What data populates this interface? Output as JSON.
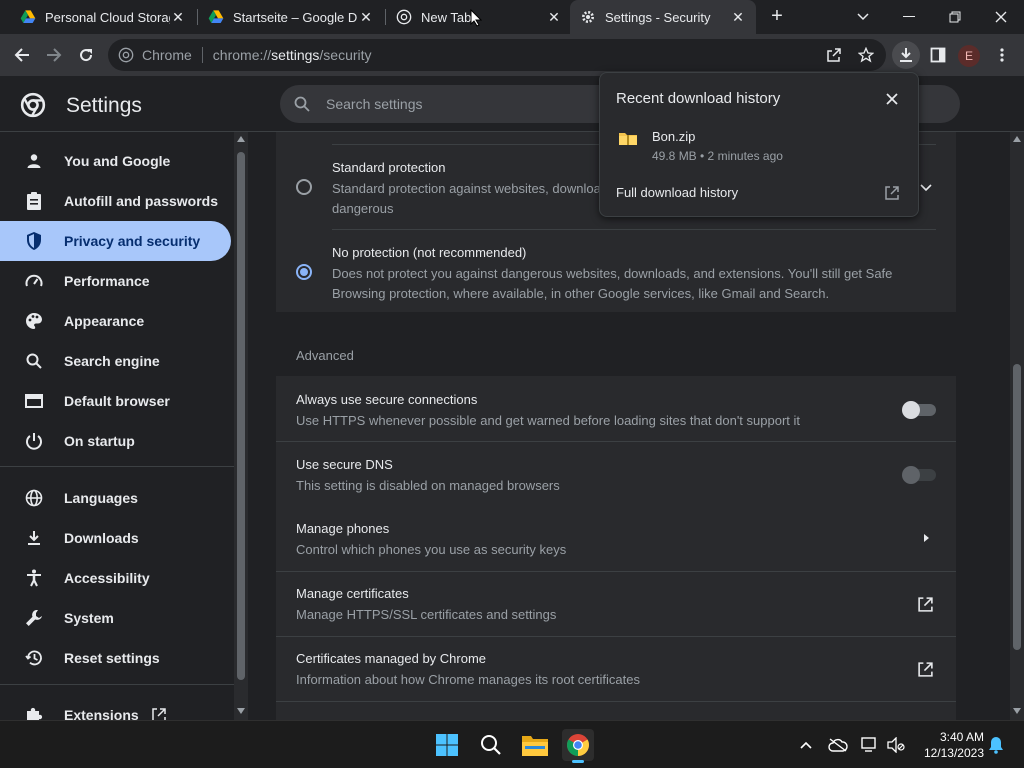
{
  "tabs": [
    {
      "title": "Personal Cloud Storag",
      "icon": "google-drive-icon"
    },
    {
      "title": "Startseite – Google Dr",
      "icon": "google-drive-icon"
    },
    {
      "title": "New Tab",
      "icon": "chrome-icon"
    },
    {
      "title": "Settings - Security",
      "icon": "gear-icon",
      "active": true
    }
  ],
  "omnibox": {
    "chip": "Chrome",
    "url_scheme": "chrome://",
    "url_host": "settings",
    "url_path": "/security"
  },
  "avatar_letter": "E",
  "settings": {
    "title": "Settings",
    "search_placeholder": "Search settings"
  },
  "sidebar": {
    "items": [
      {
        "label": "You and Google",
        "icon": "person-icon"
      },
      {
        "label": "Autofill and passwords",
        "icon": "clipboard-icon"
      },
      {
        "label": "Privacy and security",
        "icon": "shield-icon",
        "selected": true
      },
      {
        "label": "Performance",
        "icon": "speedometer-icon"
      },
      {
        "label": "Appearance",
        "icon": "palette-icon"
      },
      {
        "label": "Search engine",
        "icon": "search-icon"
      },
      {
        "label": "Default browser",
        "icon": "browser-icon"
      },
      {
        "label": "On startup",
        "icon": "power-icon"
      },
      {
        "label": "Languages",
        "icon": "globe-icon"
      },
      {
        "label": "Downloads",
        "icon": "download-icon"
      },
      {
        "label": "Accessibility",
        "icon": "accessibility-icon"
      },
      {
        "label": "System",
        "icon": "wrench-icon"
      },
      {
        "label": "Reset settings",
        "icon": "history-icon"
      },
      {
        "label": "Extensions",
        "icon": "puzzle-icon"
      }
    ]
  },
  "protection": {
    "standard": {
      "title": "Standard protection",
      "desc_line1": "Standard protection against websites, downloa",
      "desc_line2": "dangerous"
    },
    "none": {
      "title": "No protection (not recommended)",
      "desc_line1": "Does not protect you against dangerous websites, downloads, and extensions. You'll still get Safe",
      "desc_line2": "Browsing protection, where available, in other Google services, like Gmail and Search."
    }
  },
  "advanced": {
    "heading": "Advanced",
    "rows": [
      {
        "title": "Always use secure connections",
        "sub": "Use HTTPS whenever possible and get warned before loading sites that don't support it",
        "control": "toggle-off"
      },
      {
        "title": "Use secure DNS",
        "sub": "This setting is disabled on managed browsers",
        "control": "toggle-disabled"
      },
      {
        "title": "Manage phones",
        "sub": "Control which phones you use as security keys",
        "control": "arrow"
      },
      {
        "title": "Manage certificates",
        "sub": "Manage HTTPS/SSL certificates and settings",
        "control": "external"
      },
      {
        "title": "Certificates managed by Chrome",
        "sub": "Information about how Chrome manages its root certificates",
        "control": "external"
      }
    ]
  },
  "download_popup": {
    "title": "Recent download history",
    "file_name": "Bon.zip",
    "file_meta": "49.8 MB • 2 minutes ago",
    "link": "Full download history"
  },
  "taskbar": {
    "time": "3:40 AM",
    "date": "12/13/2023"
  },
  "colors": {
    "accent": "#8ab4f8",
    "selected_nav_bg": "#a8c7fa",
    "background": "#202124",
    "card": "#292a2d"
  }
}
